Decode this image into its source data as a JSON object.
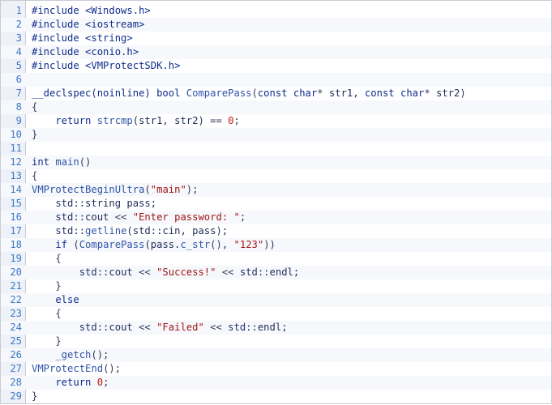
{
  "viewer": {
    "first_line": 1
  },
  "code_lines": [
    [
      {
        "t": "#include <Windows.h>",
        "c": "pp"
      }
    ],
    [
      {
        "t": "#include <iostream>",
        "c": "pp"
      }
    ],
    [
      {
        "t": "#include <string>",
        "c": "pp"
      }
    ],
    [
      {
        "t": "#include <conio.h>",
        "c": "pp"
      }
    ],
    [
      {
        "t": "#include <VMProtectSDK.h>",
        "c": "pp"
      }
    ],
    [],
    [
      {
        "t": "__declspec(noinline) ",
        "c": "kw"
      },
      {
        "t": "bool ",
        "c": "type"
      },
      {
        "t": "ComparePass",
        "c": "fn"
      },
      {
        "t": "(",
        "c": "op"
      },
      {
        "t": "const ",
        "c": "kw"
      },
      {
        "t": "char",
        "c": "type"
      },
      {
        "t": "* ",
        "c": "op"
      },
      {
        "t": "str1, ",
        "c": "ident"
      },
      {
        "t": "const ",
        "c": "kw"
      },
      {
        "t": "char",
        "c": "type"
      },
      {
        "t": "* ",
        "c": "op"
      },
      {
        "t": "str2",
        "c": "ident"
      },
      {
        "t": ")",
        "c": "op"
      }
    ],
    [
      {
        "t": "{",
        "c": "op"
      }
    ],
    [
      {
        "t": "    return ",
        "c": "kw"
      },
      {
        "t": "strcmp",
        "c": "fn"
      },
      {
        "t": "(str1, str2) ",
        "c": "ident"
      },
      {
        "t": "== ",
        "c": "op"
      },
      {
        "t": "0",
        "c": "num"
      },
      {
        "t": ";",
        "c": "op"
      }
    ],
    [
      {
        "t": "}",
        "c": "op"
      }
    ],
    [],
    [
      {
        "t": "int ",
        "c": "type"
      },
      {
        "t": "main",
        "c": "fn"
      },
      {
        "t": "()",
        "c": "op"
      }
    ],
    [
      {
        "t": "{",
        "c": "op"
      }
    ],
    [
      {
        "t": "VMProtectBeginUltra",
        "c": "fn"
      },
      {
        "t": "(",
        "c": "op"
      },
      {
        "t": "\"main\"",
        "c": "str"
      },
      {
        "t": ");",
        "c": "op"
      }
    ],
    [
      {
        "t": "    std::",
        "c": "ns"
      },
      {
        "t": "string ",
        "c": "ident"
      },
      {
        "t": "pass;",
        "c": "ident"
      }
    ],
    [
      {
        "t": "    std::",
        "c": "ns"
      },
      {
        "t": "cout ",
        "c": "ident"
      },
      {
        "t": "<< ",
        "c": "op"
      },
      {
        "t": "\"Enter password: \"",
        "c": "str"
      },
      {
        "t": ";",
        "c": "op"
      }
    ],
    [
      {
        "t": "    std::",
        "c": "ns"
      },
      {
        "t": "getline",
        "c": "fn"
      },
      {
        "t": "(std::cin, pass);",
        "c": "ident"
      }
    ],
    [
      {
        "t": "    if ",
        "c": "kw"
      },
      {
        "t": "(",
        "c": "op"
      },
      {
        "t": "ComparePass",
        "c": "fn"
      },
      {
        "t": "(pass.",
        "c": "ident"
      },
      {
        "t": "c_str",
        "c": "fn"
      },
      {
        "t": "(), ",
        "c": "op"
      },
      {
        "t": "\"123\"",
        "c": "str"
      },
      {
        "t": "))",
        "c": "op"
      }
    ],
    [
      {
        "t": "    {",
        "c": "op"
      }
    ],
    [
      {
        "t": "        std::",
        "c": "ns"
      },
      {
        "t": "cout ",
        "c": "ident"
      },
      {
        "t": "<< ",
        "c": "op"
      },
      {
        "t": "\"Success!\" ",
        "c": "str"
      },
      {
        "t": "<< ",
        "c": "op"
      },
      {
        "t": "std::",
        "c": "ns"
      },
      {
        "t": "endl;",
        "c": "ident"
      }
    ],
    [
      {
        "t": "    }",
        "c": "op"
      }
    ],
    [
      {
        "t": "    else",
        "c": "kw"
      }
    ],
    [
      {
        "t": "    {",
        "c": "op"
      }
    ],
    [
      {
        "t": "        std::",
        "c": "ns"
      },
      {
        "t": "cout ",
        "c": "ident"
      },
      {
        "t": "<< ",
        "c": "op"
      },
      {
        "t": "\"Failed\" ",
        "c": "str"
      },
      {
        "t": "<< ",
        "c": "op"
      },
      {
        "t": "std::",
        "c": "ns"
      },
      {
        "t": "endl;",
        "c": "ident"
      }
    ],
    [
      {
        "t": "    }",
        "c": "op"
      }
    ],
    [
      {
        "t": "    _getch",
        "c": "fn"
      },
      {
        "t": "();",
        "c": "op"
      }
    ],
    [
      {
        "t": "VMProtectEnd",
        "c": "fn"
      },
      {
        "t": "();",
        "c": "op"
      }
    ],
    [
      {
        "t": "    return ",
        "c": "kw"
      },
      {
        "t": "0",
        "c": "num"
      },
      {
        "t": ";",
        "c": "op"
      }
    ],
    [
      {
        "t": "}",
        "c": "op"
      }
    ]
  ]
}
